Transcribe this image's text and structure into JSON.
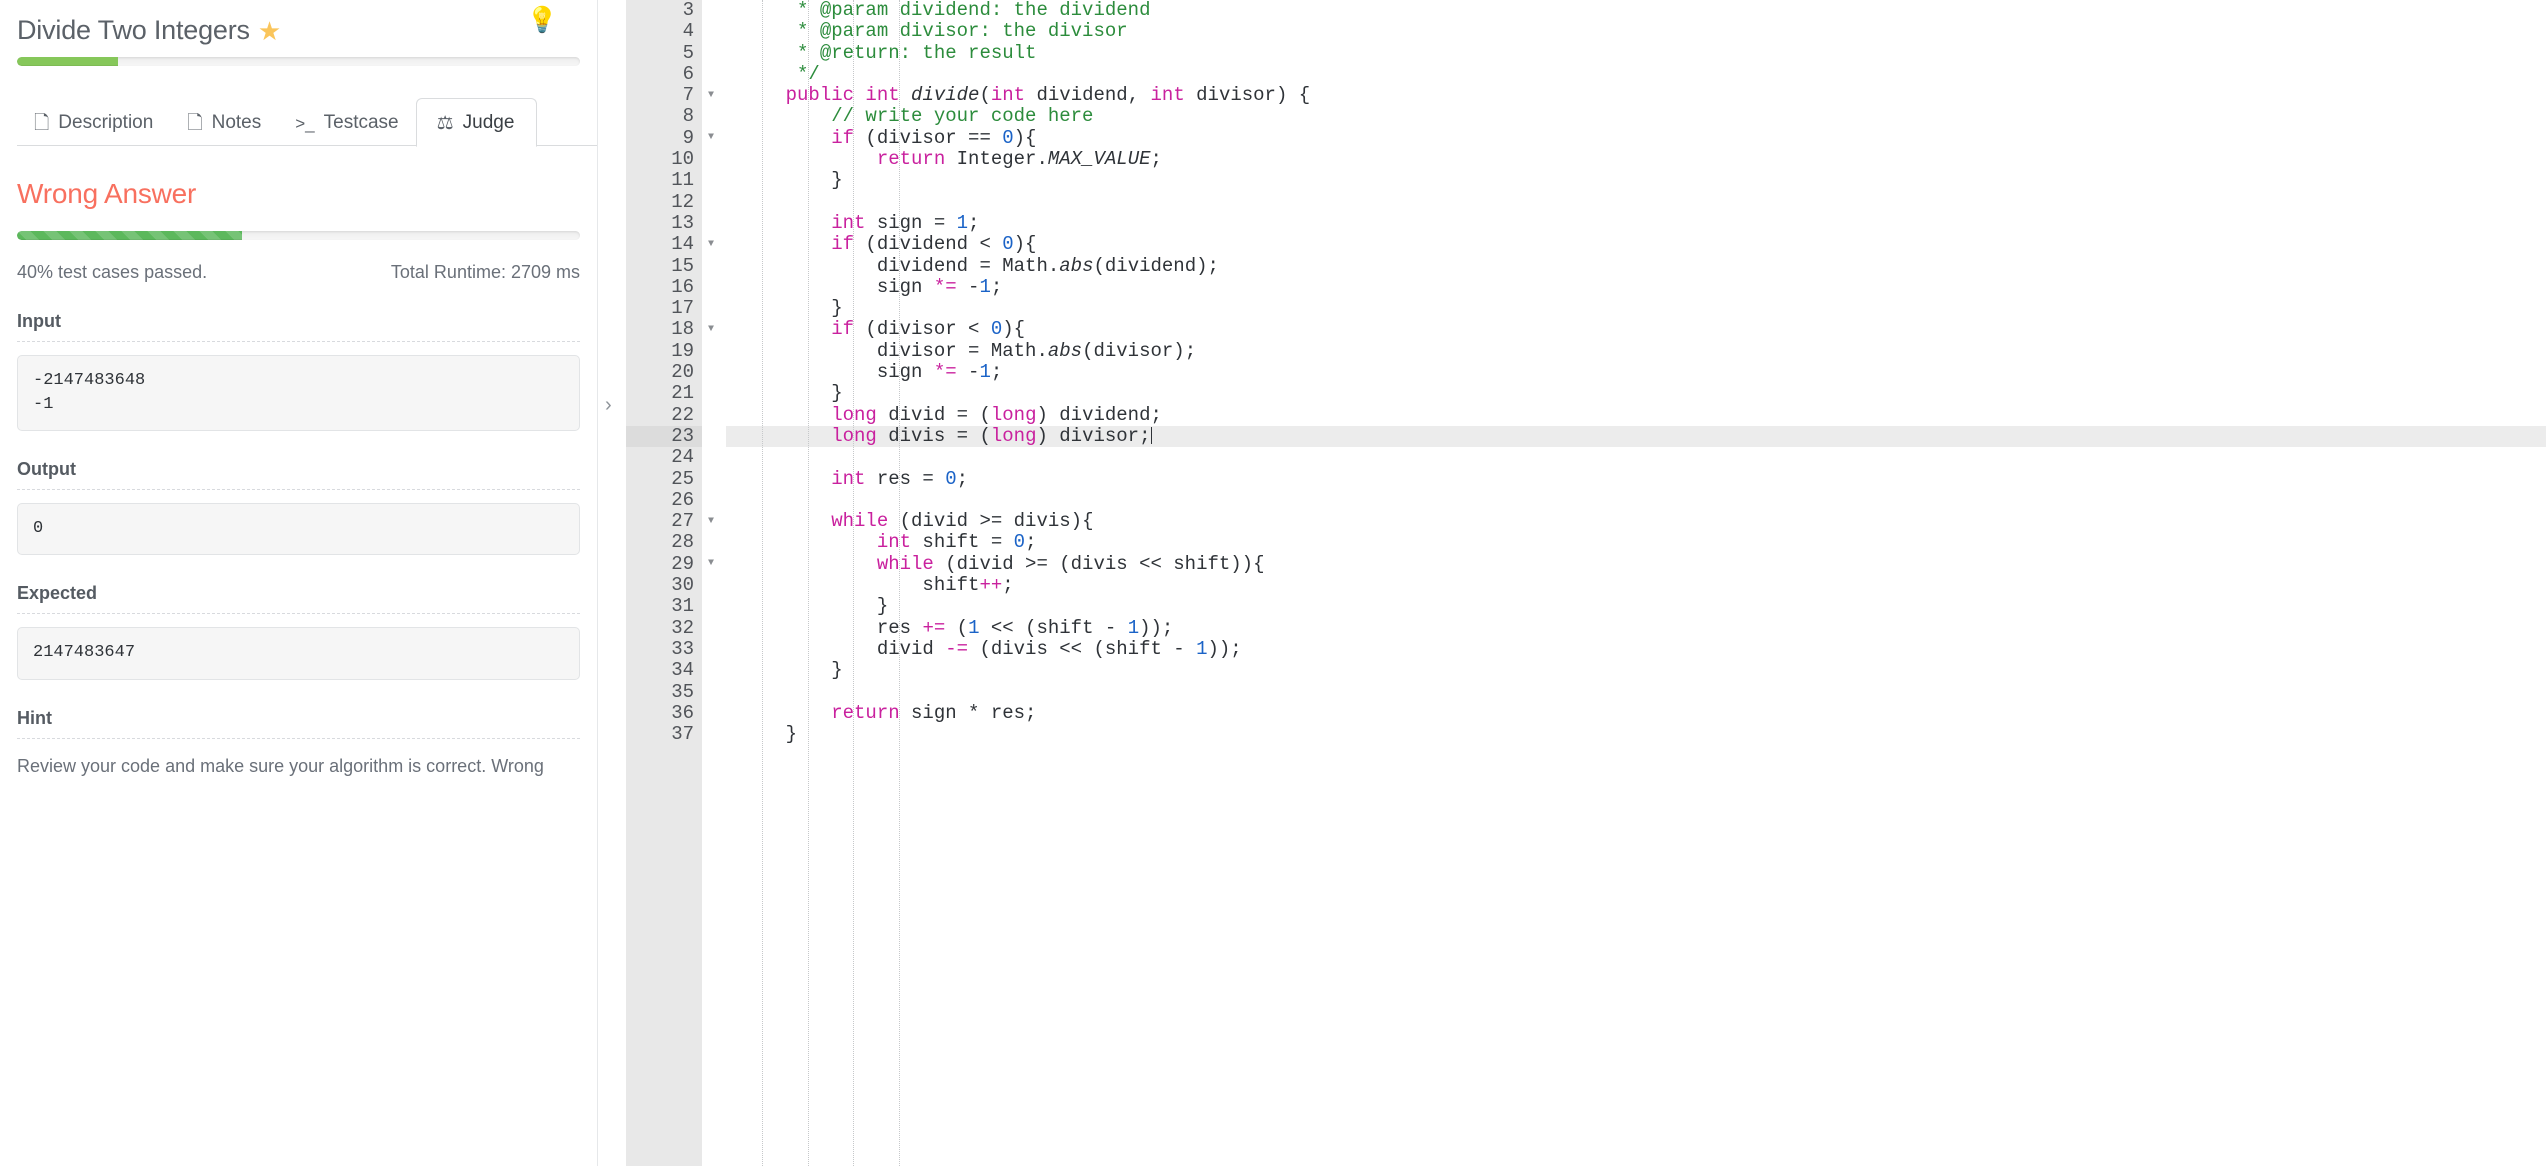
{
  "problem": {
    "title": "Divide Two Integers",
    "star_icon": "star-icon",
    "bulb_icon": "lightbulb-icon",
    "difficulty_progress_percent": 18,
    "accent_green": "#86c75a",
    "accent_star": "#fac55b",
    "accent_bulb": "#f0ad4e"
  },
  "tabs": [
    {
      "label": "Description",
      "icon": "document-icon",
      "glyph": "Ὓ9",
      "active": false
    },
    {
      "label": "Notes",
      "icon": "note-icon",
      "glyph": "◱",
      "active": false
    },
    {
      "label": "Testcase",
      "icon": "terminal-icon",
      "glyph": ">_",
      "active": false
    },
    {
      "label": "Judge",
      "icon": "scales-icon",
      "glyph": "⚖",
      "active": true
    }
  ],
  "judge": {
    "verdict": "Wrong Answer",
    "verdict_color": "#f8705f",
    "test_progress_percent": 40,
    "tests_passed_text": "40% test cases passed.",
    "runtime_text": "Total Runtime: 2709 ms",
    "sections": [
      {
        "label": "Input",
        "value": "-2147483648\n-1"
      },
      {
        "label": "Output",
        "value": "0"
      },
      {
        "label": "Expected",
        "value": "2147483647"
      },
      {
        "label": "Hint",
        "value": "Review your code and make sure your algorithm is correct. Wrong"
      }
    ]
  },
  "collapse_handle": {
    "icon": "chevron-right-icon",
    "glyph": "›"
  },
  "editor": {
    "active_line": 23,
    "first_visible_line": 3,
    "lines": [
      {
        "n": 3,
        "fold": false,
        "tokens": [
          {
            "t": "cmt",
            "s": "     * @param dividend: the dividend"
          }
        ]
      },
      {
        "n": 4,
        "fold": false,
        "tokens": [
          {
            "t": "cmt",
            "s": "     * @param divisor: the divisor"
          }
        ]
      },
      {
        "n": 5,
        "fold": false,
        "tokens": [
          {
            "t": "cmt",
            "s": "     * @return: the result"
          }
        ]
      },
      {
        "n": 6,
        "fold": false,
        "tokens": [
          {
            "t": "cmt",
            "s": "     */"
          }
        ]
      },
      {
        "n": 7,
        "fold": true,
        "tokens": [
          {
            "t": "kw",
            "s": "    public "
          },
          {
            "t": "type",
            "s": "int"
          },
          {
            "t": "pln",
            "s": " "
          },
          {
            "t": "fn",
            "s": "divide"
          },
          {
            "t": "pln",
            "s": "("
          },
          {
            "t": "type",
            "s": "int"
          },
          {
            "t": "pln",
            "s": " dividend, "
          },
          {
            "t": "type",
            "s": "int"
          },
          {
            "t": "pln",
            "s": " divisor) {"
          }
        ]
      },
      {
        "n": 8,
        "fold": false,
        "tokens": [
          {
            "t": "cmt",
            "s": "        // write your code here"
          }
        ]
      },
      {
        "n": 9,
        "fold": true,
        "tokens": [
          {
            "t": "kw",
            "s": "        if "
          },
          {
            "t": "pln",
            "s": "(divisor == "
          },
          {
            "t": "num",
            "s": "0"
          },
          {
            "t": "pln",
            "s": "){"
          }
        ]
      },
      {
        "n": 10,
        "fold": false,
        "tokens": [
          {
            "t": "kw",
            "s": "            return "
          },
          {
            "t": "cls",
            "s": "Integer"
          },
          {
            "t": "pln",
            "s": "."
          },
          {
            "t": "fn",
            "s": "MAX_VALUE"
          },
          {
            "t": "pln",
            "s": ";"
          }
        ]
      },
      {
        "n": 11,
        "fold": false,
        "tokens": [
          {
            "t": "pln",
            "s": "        }"
          }
        ]
      },
      {
        "n": 12,
        "fold": false,
        "tokens": [
          {
            "t": "pln",
            "s": ""
          }
        ]
      },
      {
        "n": 13,
        "fold": false,
        "tokens": [
          {
            "t": "type",
            "s": "        int"
          },
          {
            "t": "pln",
            "s": " sign = "
          },
          {
            "t": "num",
            "s": "1"
          },
          {
            "t": "pln",
            "s": ";"
          }
        ]
      },
      {
        "n": 14,
        "fold": true,
        "tokens": [
          {
            "t": "kw",
            "s": "        if "
          },
          {
            "t": "pln",
            "s": "(dividend < "
          },
          {
            "t": "num",
            "s": "0"
          },
          {
            "t": "pln",
            "s": "){"
          }
        ]
      },
      {
        "n": 15,
        "fold": false,
        "tokens": [
          {
            "t": "pln",
            "s": "            dividend = "
          },
          {
            "t": "cls",
            "s": "Math"
          },
          {
            "t": "pln",
            "s": "."
          },
          {
            "t": "fn",
            "s": "abs"
          },
          {
            "t": "pln",
            "s": "(dividend);"
          }
        ]
      },
      {
        "n": 16,
        "fold": false,
        "tokens": [
          {
            "t": "pln",
            "s": "            sign "
          },
          {
            "t": "kw",
            "s": "*="
          },
          {
            "t": "pln",
            "s": " -"
          },
          {
            "t": "num",
            "s": "1"
          },
          {
            "t": "pln",
            "s": ";"
          }
        ]
      },
      {
        "n": 17,
        "fold": false,
        "tokens": [
          {
            "t": "pln",
            "s": "        }"
          }
        ]
      },
      {
        "n": 18,
        "fold": true,
        "tokens": [
          {
            "t": "kw",
            "s": "        if "
          },
          {
            "t": "pln",
            "s": "(divisor < "
          },
          {
            "t": "num",
            "s": "0"
          },
          {
            "t": "pln",
            "s": "){"
          }
        ]
      },
      {
        "n": 19,
        "fold": false,
        "tokens": [
          {
            "t": "pln",
            "s": "            divisor = "
          },
          {
            "t": "cls",
            "s": "Math"
          },
          {
            "t": "pln",
            "s": "."
          },
          {
            "t": "fn",
            "s": "abs"
          },
          {
            "t": "pln",
            "s": "(divisor);"
          }
        ]
      },
      {
        "n": 20,
        "fold": false,
        "tokens": [
          {
            "t": "pln",
            "s": "            sign "
          },
          {
            "t": "kw",
            "s": "*="
          },
          {
            "t": "pln",
            "s": " -"
          },
          {
            "t": "num",
            "s": "1"
          },
          {
            "t": "pln",
            "s": ";"
          }
        ]
      },
      {
        "n": 21,
        "fold": false,
        "tokens": [
          {
            "t": "pln",
            "s": "        }"
          }
        ]
      },
      {
        "n": 22,
        "fold": false,
        "tokens": [
          {
            "t": "type",
            "s": "        long"
          },
          {
            "t": "pln",
            "s": " divid = ("
          },
          {
            "t": "type",
            "s": "long"
          },
          {
            "t": "pln",
            "s": ") dividend;"
          }
        ]
      },
      {
        "n": 23,
        "fold": false,
        "active": true,
        "cursor": true,
        "tokens": [
          {
            "t": "type",
            "s": "        long"
          },
          {
            "t": "pln",
            "s": " divis = ("
          },
          {
            "t": "type",
            "s": "long"
          },
          {
            "t": "pln",
            "s": ") divisor;"
          }
        ]
      },
      {
        "n": 24,
        "fold": false,
        "tokens": [
          {
            "t": "pln",
            "s": ""
          }
        ]
      },
      {
        "n": 25,
        "fold": false,
        "tokens": [
          {
            "t": "type",
            "s": "        int"
          },
          {
            "t": "pln",
            "s": " res = "
          },
          {
            "t": "num",
            "s": "0"
          },
          {
            "t": "pln",
            "s": ";"
          }
        ]
      },
      {
        "n": 26,
        "fold": false,
        "tokens": [
          {
            "t": "pln",
            "s": ""
          }
        ]
      },
      {
        "n": 27,
        "fold": true,
        "tokens": [
          {
            "t": "kw",
            "s": "        while "
          },
          {
            "t": "pln",
            "s": "(divid >= divis){"
          }
        ]
      },
      {
        "n": 28,
        "fold": false,
        "tokens": [
          {
            "t": "type",
            "s": "            int"
          },
          {
            "t": "pln",
            "s": " shift = "
          },
          {
            "t": "num",
            "s": "0"
          },
          {
            "t": "pln",
            "s": ";"
          }
        ]
      },
      {
        "n": 29,
        "fold": true,
        "tokens": [
          {
            "t": "kw",
            "s": "            while "
          },
          {
            "t": "pln",
            "s": "(divid >= (divis << shift)){"
          }
        ]
      },
      {
        "n": 30,
        "fold": false,
        "tokens": [
          {
            "t": "pln",
            "s": "                shift"
          },
          {
            "t": "kw",
            "s": "++"
          },
          {
            "t": "pln",
            "s": ";"
          }
        ]
      },
      {
        "n": 31,
        "fold": false,
        "tokens": [
          {
            "t": "pln",
            "s": "            }"
          }
        ]
      },
      {
        "n": 32,
        "fold": false,
        "tokens": [
          {
            "t": "pln",
            "s": "            res "
          },
          {
            "t": "kw",
            "s": "+="
          },
          {
            "t": "pln",
            "s": " ("
          },
          {
            "t": "num",
            "s": "1"
          },
          {
            "t": "pln",
            "s": " << (shift - "
          },
          {
            "t": "num",
            "s": "1"
          },
          {
            "t": "pln",
            "s": "));"
          }
        ]
      },
      {
        "n": 33,
        "fold": false,
        "tokens": [
          {
            "t": "pln",
            "s": "            divid "
          },
          {
            "t": "kw",
            "s": "-="
          },
          {
            "t": "pln",
            "s": " (divis << (shift - "
          },
          {
            "t": "num",
            "s": "1"
          },
          {
            "t": "pln",
            "s": "));"
          }
        ]
      },
      {
        "n": 34,
        "fold": false,
        "tokens": [
          {
            "t": "pln",
            "s": "        }"
          }
        ]
      },
      {
        "n": 35,
        "fold": false,
        "tokens": [
          {
            "t": "pln",
            "s": ""
          }
        ]
      },
      {
        "n": 36,
        "fold": false,
        "tokens": [
          {
            "t": "kw",
            "s": "        return "
          },
          {
            "t": "pln",
            "s": "sign * res;"
          }
        ]
      },
      {
        "n": 37,
        "fold": false,
        "tokens": [
          {
            "t": "pln",
            "s": "    }"
          }
        ]
      }
    ]
  }
}
